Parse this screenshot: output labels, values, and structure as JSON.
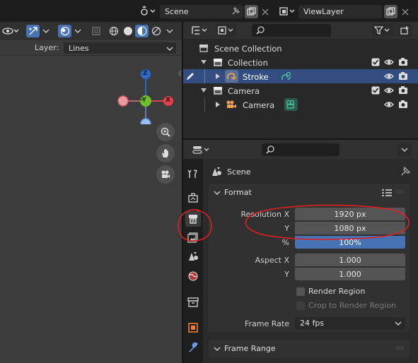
{
  "topbar": {
    "scene_name": "Scene",
    "viewlayer_name": "ViewLayer"
  },
  "viewport": {
    "layer_label": "Layer:",
    "layer_value": "Lines",
    "gizmo": {
      "z": "Z",
      "y": "-Y",
      "x": "X"
    }
  },
  "outliner": {
    "search_placeholder": "",
    "rows": [
      {
        "label": "Scene Collection"
      },
      {
        "label": "Collection"
      },
      {
        "label": "Stroke"
      },
      {
        "label": "Camera"
      },
      {
        "label": "Camera"
      }
    ]
  },
  "properties": {
    "search_placeholder": "",
    "context": "Scene",
    "format_panel": {
      "title": "Format",
      "resolution_x_label": "Resolution X",
      "resolution_x_value": "1920 px",
      "resolution_y_label": "Y",
      "resolution_y_value": "1080 px",
      "percent_label": "%",
      "percent_value": "100%",
      "aspect_x_label": "Aspect X",
      "aspect_x_value": "1.000",
      "aspect_y_label": "Y",
      "aspect_y_value": "1.000",
      "render_region_label": "Render Region",
      "crop_label": "Crop to Render Region",
      "frame_rate_label": "Frame Rate",
      "frame_rate_value": "24 fps"
    },
    "frame_range_panel": {
      "title": "Frame Range"
    }
  },
  "colors": {
    "selection_blue": "#334d80",
    "field_blue": "#4772b3",
    "gizmo_z": "#2c6bcc",
    "gizmo_y": "#6fbf2a",
    "gizmo_x": "#e3404d",
    "annotation_red": "#e21f1f"
  }
}
